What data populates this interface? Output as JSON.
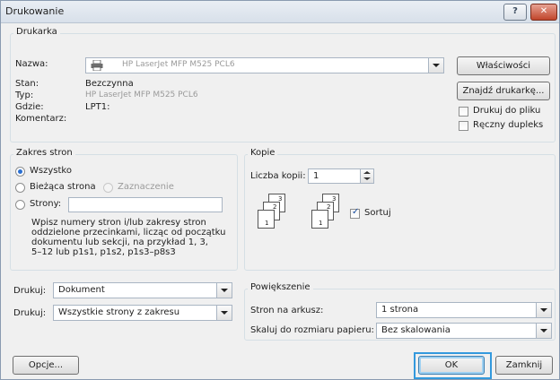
{
  "window": {
    "title": "Drukowanie",
    "help_label": "?",
    "close_label": "✕"
  },
  "printer": {
    "legend": "Drukarka",
    "name_label": "Nazwa:",
    "name_value": "HP LaserJet MFP M525 PCL6",
    "status_label": "Stan:",
    "status_value": "Bezczynna",
    "type_label": "Typ:",
    "type_value": "HP LaserJet MFP M525 PCL6",
    "where_label": "Gdzie:",
    "where_value": "LPT1:",
    "comment_label": "Komentarz:",
    "properties_button": "Właściwości",
    "find_button": "Znajdź drukarkę...",
    "print_to_file": "Drukuj do pliku",
    "print_to_file_checked": false,
    "manual_duplex": "Ręczny dupleks",
    "manual_duplex_checked": false
  },
  "page_range": {
    "legend": "Zakres stron",
    "all_label": "Wszystko",
    "current_label": "Bieżąca strona",
    "selection_label": "Zaznaczenie",
    "pages_label": "Strony:",
    "pages_value": "",
    "selected": "all",
    "hint_lines": [
      "Wpisz numery stron i/lub zakresy stron",
      "oddzielone przecinkami, licząc od początku",
      "dokumentu lub sekcji, na przykład 1, 3,",
      "5–12 lub p1s1, p1s2, p1s3–p8s3"
    ]
  },
  "copies": {
    "legend": "Kopie",
    "count_label": "Liczba kopii:",
    "count_value": "1",
    "collate_label": "Sortuj",
    "collate_checked": true,
    "icon_numbers": [
      "3",
      "2",
      "1"
    ]
  },
  "print_what": {
    "label": "Drukuj:",
    "value": "Dokument"
  },
  "print": {
    "label": "Drukuj:",
    "value": "Wszystkie strony z zakresu"
  },
  "zoom": {
    "legend": "Powiększenie",
    "pages_per_sheet_label": "Stron na arkusz:",
    "pages_per_sheet_value": "1 strona",
    "scale_label": "Skaluj do rozmiaru papieru:",
    "scale_value": "Bez skalowania"
  },
  "buttons": {
    "options": "Opcje...",
    "ok": "OK",
    "close": "Zamknij"
  }
}
